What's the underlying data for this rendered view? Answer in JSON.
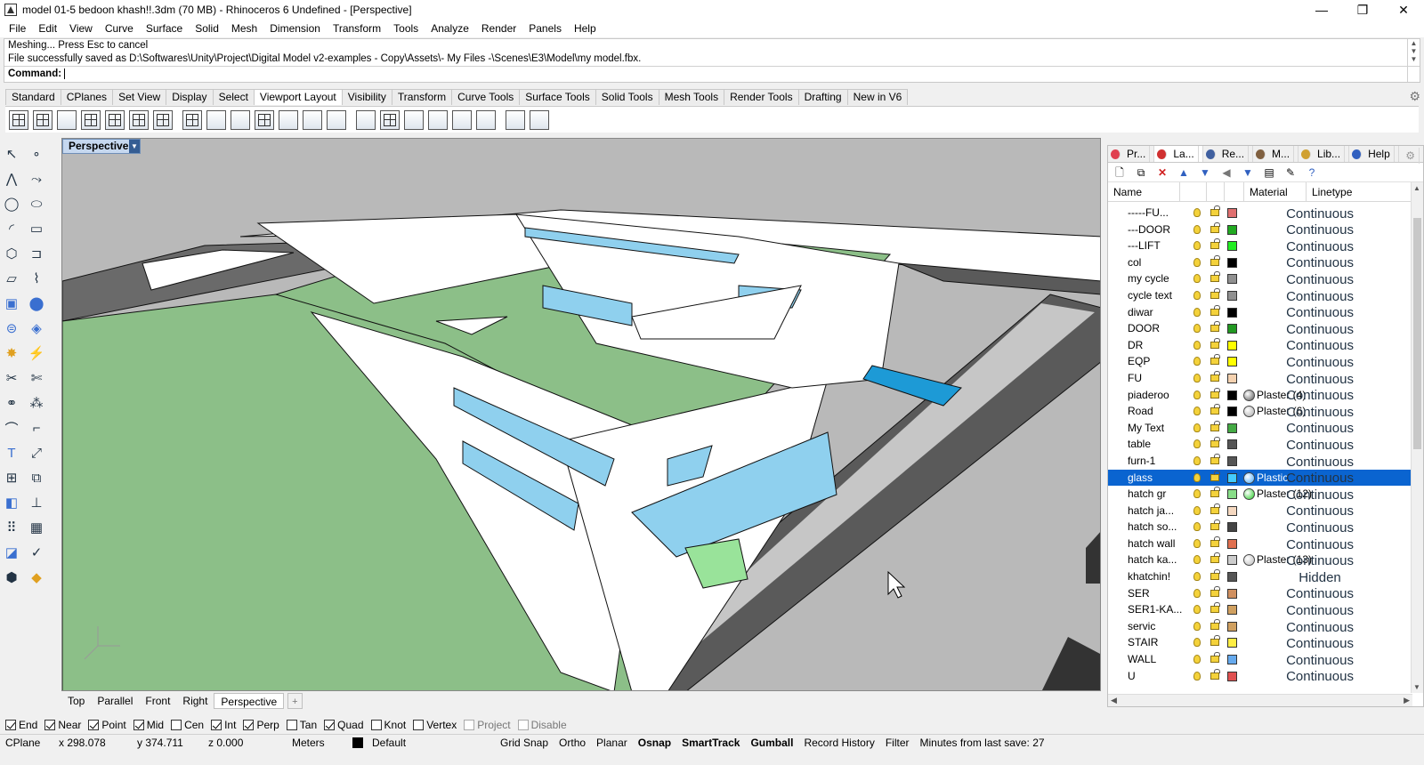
{
  "window": {
    "title": "model 01-5 bedoon khash!!.3dm (70 MB) - Rhinoceros 6 Undefined - [Perspective]",
    "min": "—",
    "max": "❐",
    "close": "✕"
  },
  "menu": [
    "File",
    "Edit",
    "View",
    "Curve",
    "Surface",
    "Solid",
    "Mesh",
    "Dimension",
    "Transform",
    "Tools",
    "Analyze",
    "Render",
    "Panels",
    "Help"
  ],
  "command": {
    "history": [
      "Meshing... Press Esc to cancel",
      "File successfully saved as D:\\Softwares\\Unity\\Project\\Digital Model v2-examples - Copy\\Assets\\- My Files -\\Scenes\\E3\\Model\\my model.fbx."
    ],
    "prompt": "Command:"
  },
  "toolbar_tabs": [
    "Standard",
    "CPlanes",
    "Set View",
    "Display",
    "Select",
    "Viewport Layout",
    "Visibility",
    "Transform",
    "Curve Tools",
    "Surface Tools",
    "Solid Tools",
    "Mesh Tools",
    "Render Tools",
    "Drafting",
    "New in V6"
  ],
  "active_tab": "Viewport Layout",
  "viewport": {
    "title": "Perspective",
    "tabs": [
      "Top",
      "Parallel",
      "Front",
      "Right",
      "Perspective"
    ],
    "add": "+"
  },
  "panel": {
    "tabs": [
      {
        "label": "Pr...",
        "color": "#e04050"
      },
      {
        "label": "La...",
        "color": "#d03030"
      },
      {
        "label": "Re...",
        "color": "#4060a0"
      },
      {
        "label": "M...",
        "color": "#806040"
      },
      {
        "label": "Lib...",
        "color": "#d0a030"
      },
      {
        "label": "Help",
        "color": "#3060c0"
      }
    ],
    "columns": {
      "name": "Name",
      "material": "Material",
      "linetype": "Linetype"
    },
    "layers": [
      {
        "name": "-----FU...",
        "color": "#e07070",
        "material": "",
        "linetype": "Continuous"
      },
      {
        "name": "---DOOR",
        "color": "#22aa22",
        "material": "",
        "linetype": "Continuous"
      },
      {
        "name": "---LIFT",
        "color": "#22ee22",
        "material": "",
        "linetype": "Continuous"
      },
      {
        "name": "col",
        "color": "#000000",
        "material": "",
        "linetype": "Continuous"
      },
      {
        "name": "my cycle",
        "color": "#909090",
        "material": "",
        "linetype": "Continuous"
      },
      {
        "name": "cycle text",
        "color": "#909090",
        "material": "",
        "linetype": "Continuous"
      },
      {
        "name": "diwar",
        "color": "#000000",
        "material": "",
        "linetype": "Continuous"
      },
      {
        "name": "DOOR",
        "color": "#229922",
        "material": "",
        "linetype": "Continuous"
      },
      {
        "name": "DR",
        "color": "#ffff00",
        "material": "",
        "linetype": "Continuous"
      },
      {
        "name": "EQP",
        "color": "#ffff00",
        "material": "",
        "linetype": "Continuous"
      },
      {
        "name": "FU",
        "color": "#f5d2b0",
        "material": "",
        "linetype": "Continuous"
      },
      {
        "name": "piaderoo",
        "color": "#000000",
        "material": "Plaster (4)",
        "matColor": "#555555",
        "linetype": "Continuous"
      },
      {
        "name": "Road",
        "color": "#000000",
        "material": "Plaster (6)",
        "matColor": "#aaaaaa",
        "linetype": "Continuous"
      },
      {
        "name": "My Text",
        "color": "#44aa44",
        "material": "",
        "linetype": "Continuous"
      },
      {
        "name": "table",
        "color": "#555555",
        "material": "",
        "linetype": "Continuous"
      },
      {
        "name": "furn-1",
        "color": "#555555",
        "material": "",
        "linetype": "Continuous"
      },
      {
        "name": "glass",
        "color": "#44ccff",
        "material": "Plastic",
        "matColor": "#44aaff",
        "linetype": "Continuous",
        "selected": true
      },
      {
        "name": "hatch gr",
        "color": "#88dd88",
        "material": "Plaster (12)",
        "matColor": "#22cc22",
        "linetype": "Continuous"
      },
      {
        "name": "hatch ja...",
        "color": "#f5d8c0",
        "material": "",
        "linetype": "Continuous"
      },
      {
        "name": "hatch so...",
        "color": "#444444",
        "material": "",
        "linetype": "Continuous"
      },
      {
        "name": "hatch wall",
        "color": "#e07050",
        "material": "",
        "linetype": "Continuous"
      },
      {
        "name": "hatch ka...",
        "color": "#cccccc",
        "material": "Plaster (13)",
        "matColor": "#bbbbbb",
        "linetype": "Continuous"
      },
      {
        "name": "khatchin!",
        "color": "#555555",
        "material": "",
        "linetype": "Hidden"
      },
      {
        "name": "SER",
        "color": "#d09060",
        "material": "",
        "linetype": "Continuous"
      },
      {
        "name": "SER1-KA...",
        "color": "#d0a060",
        "material": "",
        "linetype": "Continuous"
      },
      {
        "name": "servic",
        "color": "#d0a060",
        "material": "",
        "linetype": "Continuous"
      },
      {
        "name": "STAIR",
        "color": "#ffee44",
        "material": "",
        "linetype": "Continuous"
      },
      {
        "name": "WALL",
        "color": "#66aaee",
        "material": "",
        "linetype": "Continuous"
      },
      {
        "name": "U",
        "color": "#e05050",
        "material": "",
        "linetype": "Continuous"
      }
    ]
  },
  "osnap": [
    {
      "label": "End",
      "on": true
    },
    {
      "label": "Near",
      "on": true
    },
    {
      "label": "Point",
      "on": true
    },
    {
      "label": "Mid",
      "on": true
    },
    {
      "label": "Cen",
      "on": false
    },
    {
      "label": "Int",
      "on": true
    },
    {
      "label": "Perp",
      "on": true
    },
    {
      "label": "Tan",
      "on": false
    },
    {
      "label": "Quad",
      "on": true
    },
    {
      "label": "Knot",
      "on": false
    },
    {
      "label": "Vertex",
      "on": false
    },
    {
      "label": "Project",
      "on": false,
      "disabled": true
    },
    {
      "label": "Disable",
      "on": false,
      "disabled": true
    }
  ],
  "status": {
    "cplane": "CPlane",
    "x": "x 298.078",
    "y": "y 374.711",
    "z": "z 0.000",
    "units": "Meters",
    "layer": "Default",
    "items": [
      {
        "label": "Grid Snap",
        "bold": false
      },
      {
        "label": "Ortho",
        "bold": false
      },
      {
        "label": "Planar",
        "bold": false
      },
      {
        "label": "Osnap",
        "bold": true
      },
      {
        "label": "SmartTrack",
        "bold": true
      },
      {
        "label": "Gumball",
        "bold": true
      },
      {
        "label": "Record History",
        "bold": false
      },
      {
        "label": "Filter",
        "bold": false
      }
    ],
    "save_info": "Minutes from last save: 27"
  },
  "colors": {
    "grass": "#8cbf88",
    "wall": "#ffffff",
    "glass": "#8fd0ee",
    "ground": "#b9b9b9",
    "road": "#5a5a5a",
    "pool": "#1d9ad6",
    "selection": "#0a64d0"
  }
}
